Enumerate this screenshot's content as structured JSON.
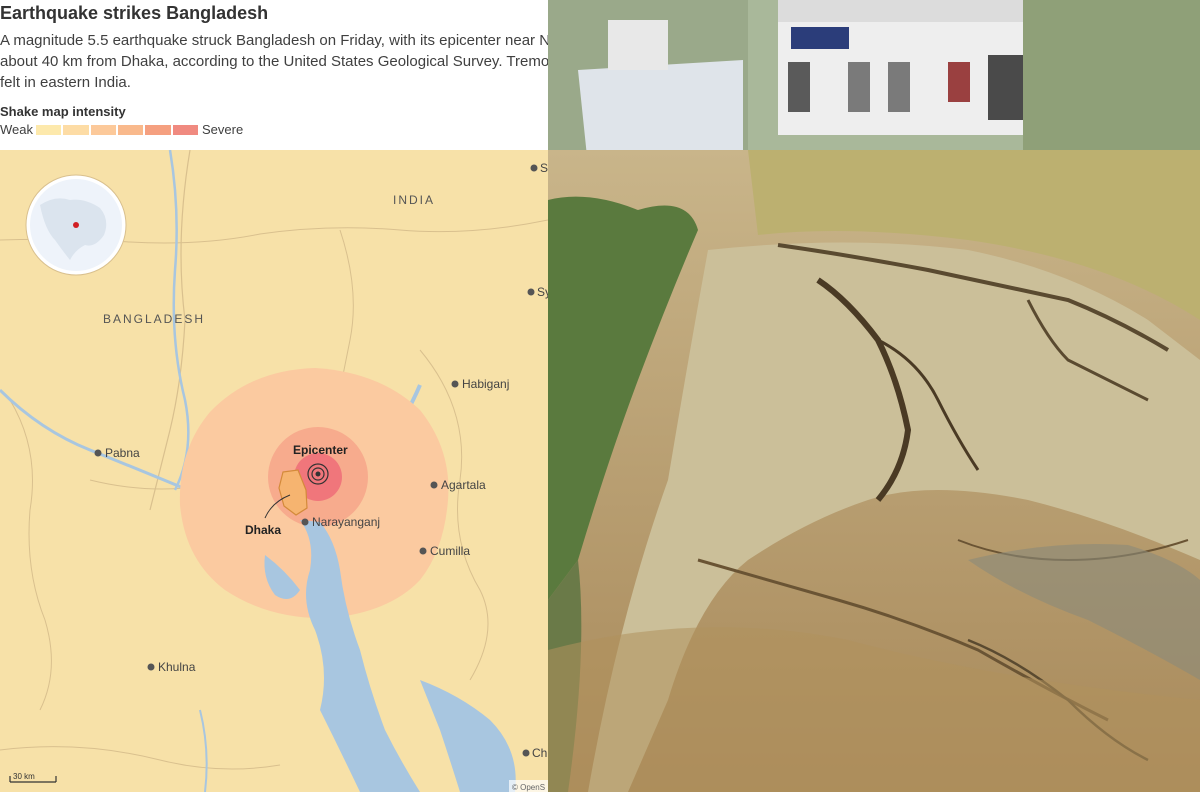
{
  "headline": "Earthquake strikes Bangladesh",
  "description": {
    "line1": "A magnitude 5.5 earthquake struck Bangladesh on Friday, with its epicenter near N",
    "line2": "about 40 km from Dhaka, according to the United States Geological Survey. Tremo",
    "line3": "felt in eastern India."
  },
  "legend": {
    "title": "Shake map intensity",
    "low_label": "Weak",
    "high_label": "Severe",
    "colors": [
      "#fde9ac",
      "#fddca5",
      "#fcc99a",
      "#f9b98c",
      "#f5a080",
      "#f08a80"
    ]
  },
  "map": {
    "regions": [
      "INDIA",
      "BANGLADESH"
    ],
    "epicenter_label": "Epicenter",
    "capital_label": "Dhaka",
    "cities": [
      "Habiganj",
      "Pabna",
      "Agartala",
      "Narayanganj",
      "Cumilla",
      "Khulna"
    ],
    "edge_labels": [
      "S",
      "Sy",
      "Ch"
    ],
    "scale_label": "30 km",
    "attribution": "© OpenS",
    "colors": {
      "land": "#f7e1a8",
      "water": "#a8c6e0",
      "shake_outer": "#fbcaa0",
      "shake_mid": "#f7ab8d",
      "epicenter_fill": "#f0767b"
    }
  },
  "photo": {
    "icons": [
      "cracked-ground-photo"
    ]
  }
}
